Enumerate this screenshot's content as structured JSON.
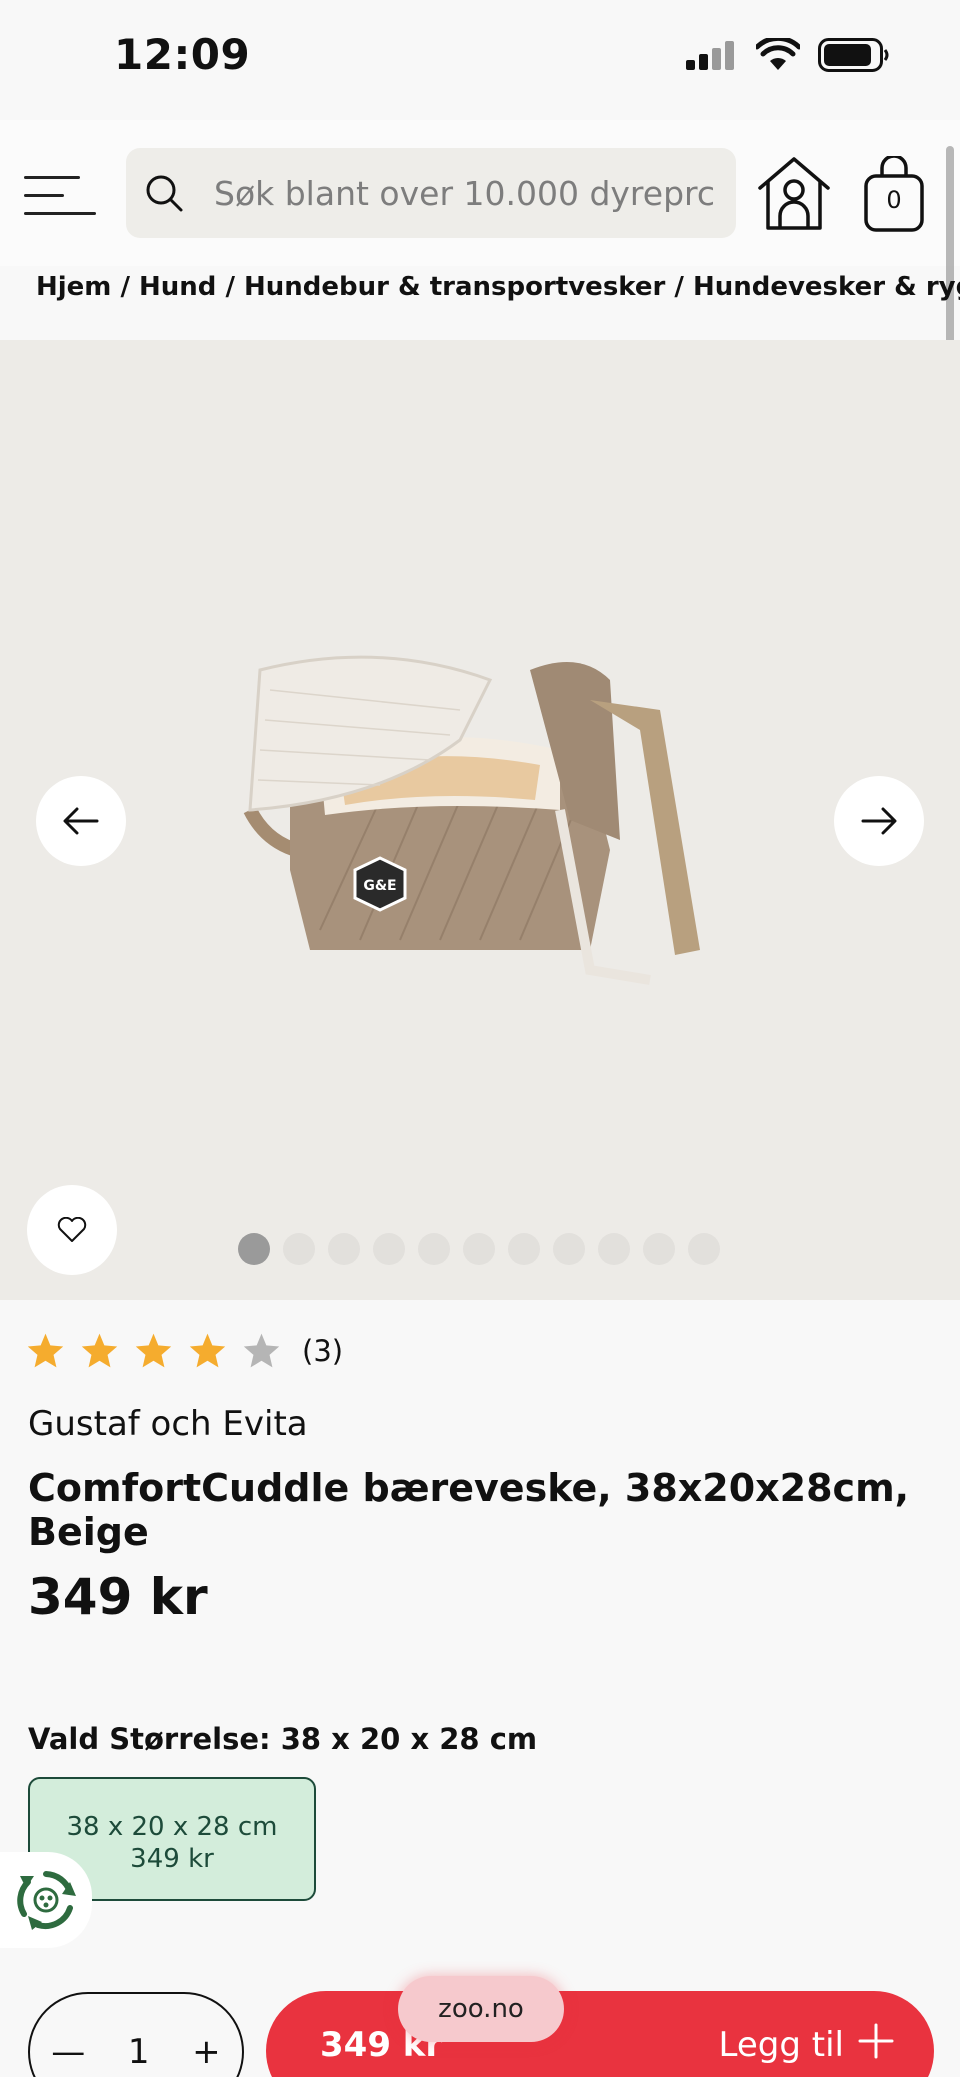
{
  "status_bar": {
    "time": "12:09"
  },
  "header": {
    "search_placeholder": "Søk blant over 10.000 dyreprc",
    "cart_count": "0"
  },
  "breadcrumb": "Hjem / Hund / Hundebur & transportvesker / Hundevesker & ryggsekker",
  "gallery": {
    "image_count": 11,
    "active_index": 0,
    "product_logo_text": "G&E"
  },
  "product": {
    "rating": 4,
    "rating_max": 5,
    "rating_count": "(3)",
    "brand": "Gustaf och Evita",
    "title": "ComfortCuddle bæreveske, 38x20x28cm, Beige",
    "price": "349 kr"
  },
  "size": {
    "label": "Vald Størrelse: 38 x 20 x 28 cm",
    "options": [
      {
        "name": "38 x 20 x 28 cm",
        "price": "349 kr"
      }
    ]
  },
  "cart_bar": {
    "qty_minus": "—",
    "quantity": "1",
    "qty_plus": "+",
    "price": "349 kr",
    "add_label": "Legg til"
  },
  "browser": {
    "url": "zoo.no"
  },
  "colors": {
    "accent": "#e9333f",
    "size_selected_bg": "#d3eddb",
    "size_selected_border": "#1d4b3a",
    "star": "#f5ac2e",
    "star_empty": "#b5b5b5",
    "gallery_bg": "#edebe7"
  }
}
